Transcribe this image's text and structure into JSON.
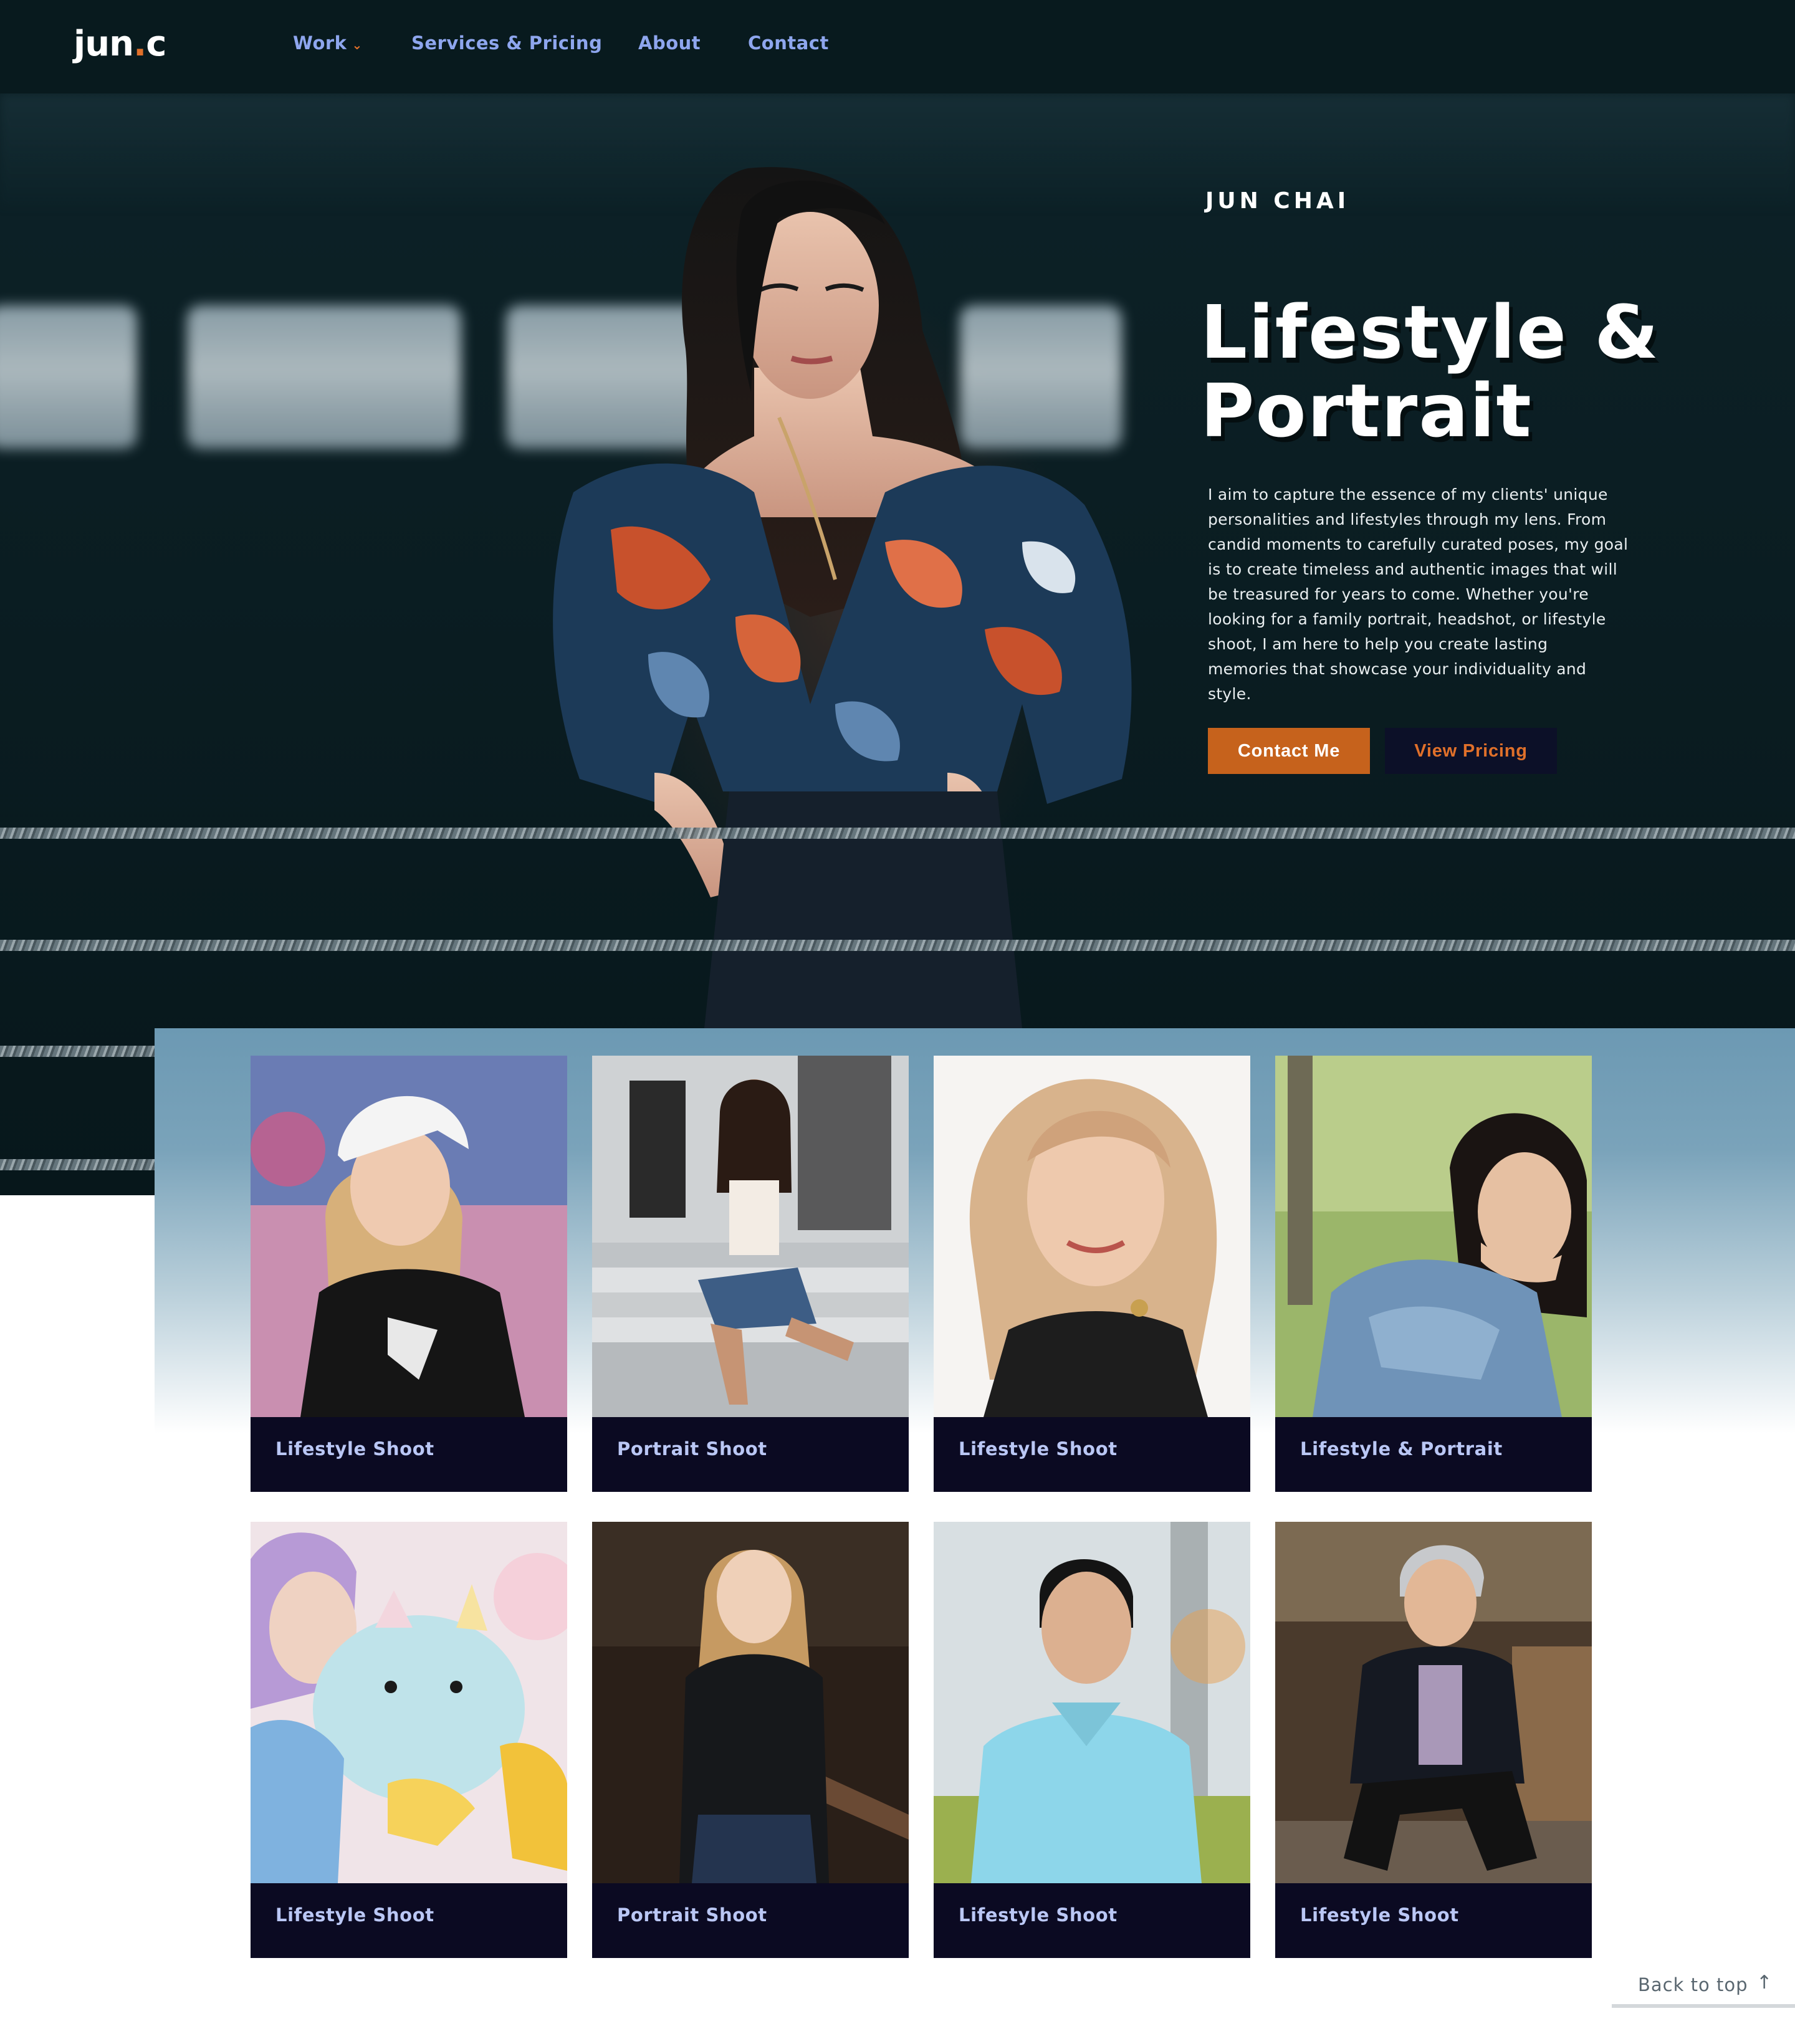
{
  "nav": {
    "logo": "jun",
    "logo_dot": ".",
    "logo_tail": "c",
    "links": [
      {
        "label": "Work",
        "has_dropdown": true
      },
      {
        "label": "Services & Pricing"
      },
      {
        "label": "About"
      },
      {
        "label": "Contact"
      }
    ],
    "caret_icon": "chevron-down-icon"
  },
  "hero": {
    "name": "JUN CHAI",
    "title": "Lifestyle & Portrait",
    "description": "I aim to capture the essence of my clients' unique personalities and lifestyles through my lens. From candid moments to carefully curated poses, my goal is to create timeless and authentic images that will be treasured for years to come. Whether you're looking for a family portrait, headshot, or lifestyle shoot, I am here to help you create lasting memories that showcase your individuality and style.",
    "contact_button": "Contact Me",
    "pricing_button": "View Pricing"
  },
  "gallery": {
    "items": [
      {
        "caption": "Lifestyle Shoot"
      },
      {
        "caption": "Portrait Shoot"
      },
      {
        "caption": "Lifestyle Shoot"
      },
      {
        "caption": "Lifestyle & Portrait"
      },
      {
        "caption": "Lifestyle Shoot"
      },
      {
        "caption": "Portrait Shoot"
      },
      {
        "caption": "Lifestyle Shoot"
      },
      {
        "caption": "Lifestyle Shoot"
      }
    ]
  },
  "footer": {
    "back_to_top": "Back to top",
    "arrow_icon": "arrow-up-icon"
  },
  "colors": {
    "accent": "#c6621c",
    "nav_bg": "#081a1e",
    "nav_link": "#8ea6ee",
    "card_bg": "#0b0a22",
    "caption": "#bac7f5"
  }
}
